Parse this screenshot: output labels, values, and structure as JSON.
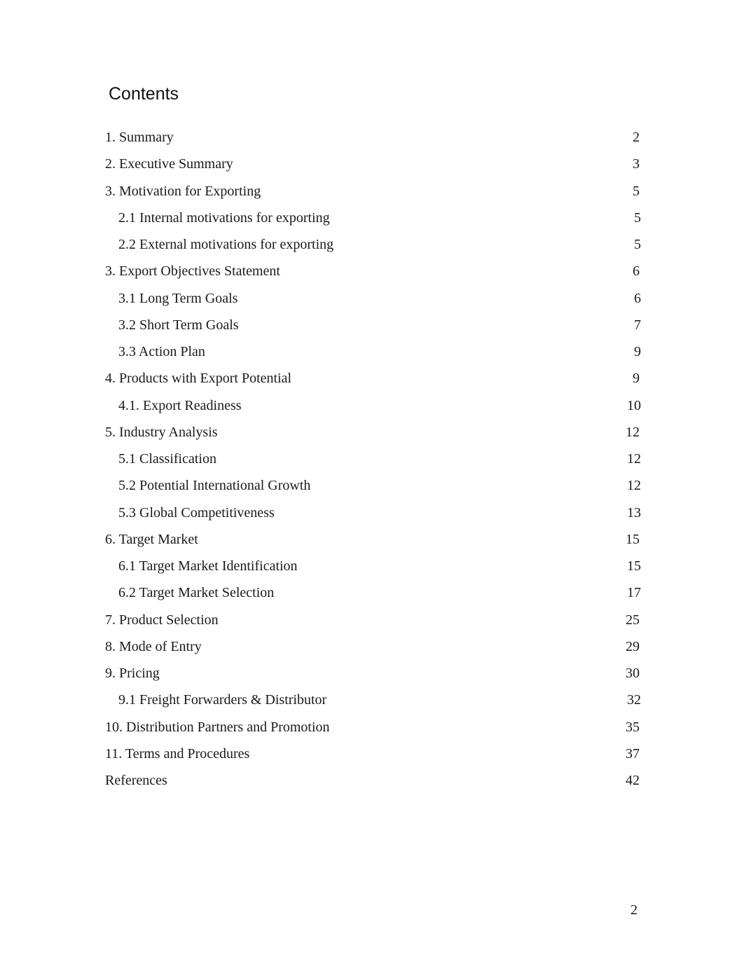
{
  "title": "Contents",
  "entries": [
    {
      "label": "1. Summary",
      "page": "2",
      "level": 1
    },
    {
      "label": "2. Executive Summary",
      "page": "3",
      "level": 1
    },
    {
      "label": "3. Motivation for Exporting",
      "page": "5",
      "level": 1
    },
    {
      "label": "2.1 Internal motivations for exporting",
      "page": "5",
      "level": 2
    },
    {
      "label": "2.2 External motivations for exporting",
      "page": "5",
      "level": 2
    },
    {
      "label": "3. Export Objectives Statement",
      "page": "6",
      "level": 1
    },
    {
      "label": "3.1 Long Term Goals",
      "page": "6",
      "level": 2
    },
    {
      "label": "3.2 Short Term Goals",
      "page": "7",
      "level": 2
    },
    {
      "label": "3.3 Action Plan",
      "page": "9",
      "level": 2
    },
    {
      "label": "4. Products with Export Potential",
      "page": "9",
      "level": 1
    },
    {
      "label": "4.1. Export Readiness",
      "page": "10",
      "level": 2
    },
    {
      "label": "5. Industry Analysis",
      "page": "12",
      "level": 1
    },
    {
      "label": "5.1 Classification",
      "page": "12",
      "level": 2
    },
    {
      "label": "5.2 Potential International Growth",
      "page": "12",
      "level": 2
    },
    {
      "label": "5.3 Global Competitiveness",
      "page": "13",
      "level": 2
    },
    {
      "label": "6. Target Market",
      "page": "15",
      "level": 1
    },
    {
      "label": "6.1 Target Market Identification",
      "page": "15",
      "level": 2
    },
    {
      "label": "6.2 Target Market Selection",
      "page": "17",
      "level": 2
    },
    {
      "label": "7. Product Selection",
      "page": "25",
      "level": 1
    },
    {
      "label": "8. Mode of Entry",
      "page": "29",
      "level": 1
    },
    {
      "label": "9. Pricing",
      "page": "30",
      "level": 1
    },
    {
      "label": "9.1 Freight Forwarders & Distributor",
      "page": "32",
      "level": 2
    },
    {
      "label": "10. Distribution Partners and Promotion",
      "page": "35",
      "level": 1
    },
    {
      "label": "11. Terms and Procedures",
      "page": "37",
      "level": 1
    },
    {
      "label": "References",
      "page": "42",
      "level": 1
    }
  ],
  "footer": {
    "page_number": "2"
  }
}
